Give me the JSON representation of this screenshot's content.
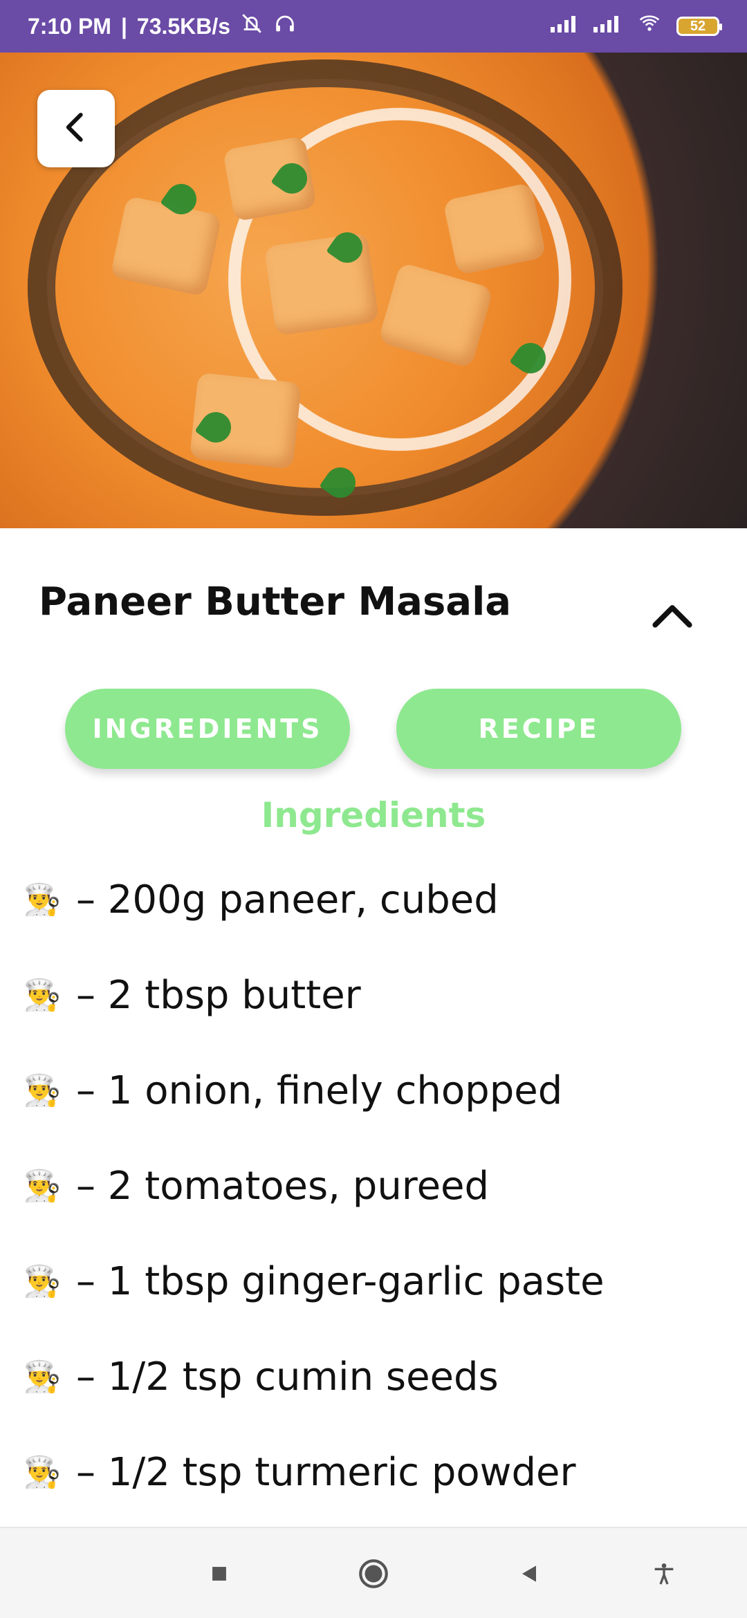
{
  "status_bar": {
    "time": "7:10 PM",
    "separator": "|",
    "speed": "73.5KB/s",
    "battery": "52",
    "colors": {
      "bg": "#6a4ba6"
    }
  },
  "hero": {
    "alt": "Paneer Butter Masala dish image"
  },
  "header": {
    "title": "Paneer Butter Masala"
  },
  "actions": {
    "ingredients_label": "INGREDIENTS",
    "recipe_label": "RECIPE"
  },
  "section": {
    "title": "Ingredients"
  },
  "ingredients": [
    {
      "text": "– 200g paneer, cubed"
    },
    {
      "text": "– 2 tbsp butter"
    },
    {
      "text": "– 1 onion, finely chopped"
    },
    {
      "text": "– 2 tomatoes, pureed"
    },
    {
      "text": "– 1 tbsp ginger-garlic paste"
    },
    {
      "text": "– 1/2 tsp cumin seeds"
    },
    {
      "text": "– 1/2 tsp turmeric powder"
    }
  ],
  "icons": {
    "back": "back-icon",
    "collapse": "chevron-up-icon",
    "chef": "chef-icon"
  },
  "colors": {
    "accent_green": "#8ee88f"
  }
}
